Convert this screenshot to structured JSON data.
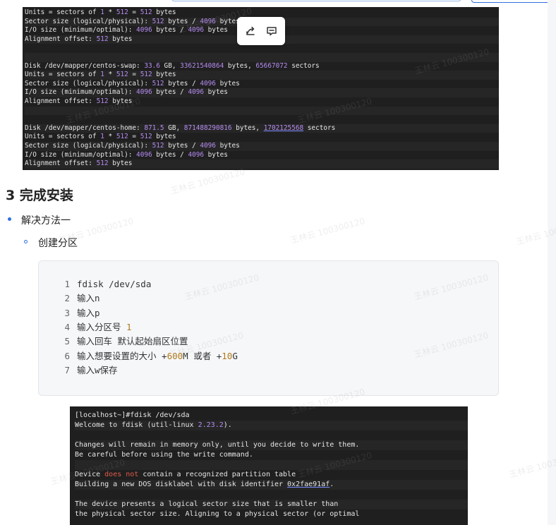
{
  "terminal_top": {
    "lines": [
      [
        [
          "Units = sectors of ",
          ""
        ],
        [
          "1",
          "n"
        ],
        [
          " * ",
          ""
        ],
        [
          "512",
          "n"
        ],
        [
          " = ",
          ""
        ],
        [
          "512",
          "n"
        ],
        [
          " bytes",
          ""
        ]
      ],
      [
        [
          "Sector size (logical/physical): ",
          ""
        ],
        [
          "512",
          "n"
        ],
        [
          " bytes / ",
          ""
        ],
        [
          "4096",
          "n"
        ],
        [
          " bytes",
          ""
        ]
      ],
      [
        [
          "I/O size (minimum/optimal): ",
          ""
        ],
        [
          "4096",
          "n"
        ],
        [
          " bytes / ",
          ""
        ],
        [
          "4096",
          "n"
        ],
        [
          " bytes",
          ""
        ]
      ],
      [
        [
          "Alignment offset: ",
          ""
        ],
        [
          "512",
          "n"
        ],
        [
          " bytes",
          ""
        ]
      ],
      [],
      [],
      [
        [
          "Disk /dev/mapper/centos-swap: ",
          ""
        ],
        [
          "33.6",
          "n"
        ],
        [
          " GB, ",
          ""
        ],
        [
          "33621540864",
          "n"
        ],
        [
          " bytes, ",
          ""
        ],
        [
          "65667072",
          "n"
        ],
        [
          " sectors",
          ""
        ]
      ],
      [
        [
          "Units = sectors of ",
          ""
        ],
        [
          "1",
          "n"
        ],
        [
          " * ",
          ""
        ],
        [
          "512",
          "n"
        ],
        [
          " = ",
          ""
        ],
        [
          "512",
          "n"
        ],
        [
          " bytes",
          ""
        ]
      ],
      [
        [
          "Sector size (logical/physical): ",
          ""
        ],
        [
          "512",
          "n"
        ],
        [
          " bytes / ",
          ""
        ],
        [
          "4096",
          "n"
        ],
        [
          " bytes",
          ""
        ]
      ],
      [
        [
          "I/O size (minimum/optimal): ",
          ""
        ],
        [
          "4096",
          "n"
        ],
        [
          " bytes / ",
          ""
        ],
        [
          "4096",
          "n"
        ],
        [
          " bytes",
          ""
        ]
      ],
      [
        [
          "Alignment offset: ",
          ""
        ],
        [
          "512",
          "n"
        ],
        [
          " bytes",
          ""
        ]
      ],
      [],
      [],
      [
        [
          "Disk /dev/mapper/centos-home: ",
          ""
        ],
        [
          "871.5",
          "n"
        ],
        [
          " GB, ",
          ""
        ],
        [
          "871488290816",
          "n"
        ],
        [
          " bytes, ",
          ""
        ],
        [
          "1702125568",
          "nu"
        ],
        [
          " sectors",
          ""
        ]
      ],
      [
        [
          "Units = sectors of ",
          ""
        ],
        [
          "1",
          "n"
        ],
        [
          " * ",
          ""
        ],
        [
          "512",
          "n"
        ],
        [
          " = ",
          ""
        ],
        [
          "512",
          "n"
        ],
        [
          " bytes",
          ""
        ]
      ],
      [
        [
          "Sector size (logical/physical): ",
          ""
        ],
        [
          "512",
          "n"
        ],
        [
          " bytes / ",
          ""
        ],
        [
          "4096",
          "n"
        ],
        [
          " bytes",
          ""
        ]
      ],
      [
        [
          "I/O size (minimum/optimal): ",
          ""
        ],
        [
          "4096",
          "n"
        ],
        [
          " bytes / ",
          ""
        ],
        [
          "4096",
          "n"
        ],
        [
          " bytes",
          ""
        ]
      ],
      [
        [
          "Alignment offset: ",
          ""
        ],
        [
          "512",
          "n"
        ],
        [
          " bytes",
          ""
        ]
      ]
    ]
  },
  "toolbar": {
    "share_icon": "share-icon",
    "comment_icon": "comment-icon"
  },
  "heading": "3 完成安装",
  "list": {
    "item1": "解决方法一",
    "sub1": "创建分区"
  },
  "code": {
    "lines": [
      {
        "num": "1",
        "parts": [
          [
            "fdisk /dev/sda",
            ""
          ]
        ]
      },
      {
        "num": "2",
        "parts": [
          [
            "输入n",
            ""
          ]
        ]
      },
      {
        "num": "3",
        "parts": [
          [
            "输入p",
            ""
          ]
        ]
      },
      {
        "num": "4",
        "parts": [
          [
            "输入分区号 ",
            ""
          ],
          [
            "1",
            "h"
          ]
        ]
      },
      {
        "num": "5",
        "parts": [
          [
            "输入回车 默认起始扇区位置",
            ""
          ]
        ]
      },
      {
        "num": "6",
        "parts": [
          [
            "输入想要设置的大小 +",
            ""
          ],
          [
            "600",
            "h"
          ],
          [
            "M 或者 +",
            ""
          ],
          [
            "10",
            "h"
          ],
          [
            "G",
            ""
          ]
        ]
      },
      {
        "num": "7",
        "parts": [
          [
            "输入w保存",
            ""
          ]
        ]
      }
    ]
  },
  "terminal_bottom": {
    "lines": [
      [
        [
          "[localhost~]#fdisk /dev/sda",
          ""
        ]
      ],
      [
        [
          "Welcome to fdisk (util-linux ",
          ""
        ],
        [
          "2.23.2",
          "n"
        ],
        [
          ").",
          ""
        ]
      ],
      [],
      [
        [
          "Changes will remain in memory only, until you decide to write them.",
          ""
        ]
      ],
      [
        [
          "Be careful before using the write command.",
          ""
        ]
      ],
      [],
      [
        [
          "Device ",
          ""
        ],
        [
          "does not",
          "r"
        ],
        [
          " contain a recognized partition table",
          ""
        ]
      ],
      [
        [
          "Building a new DOS disklabel with disk identifier ",
          ""
        ],
        [
          "0x2fae91af",
          "u"
        ],
        [
          ".",
          ""
        ]
      ],
      [],
      [
        [
          "The device presents a logical sector size that is smaller than",
          ""
        ]
      ],
      [
        [
          "the physical sector size. Aligning to a physical sector (or optimal",
          ""
        ]
      ]
    ]
  },
  "watermark": "王林云 100300120",
  "colors": {
    "accent": "#2f6fe0",
    "terminal_bg": "#1f1f1f",
    "number": "#b58cf0"
  }
}
